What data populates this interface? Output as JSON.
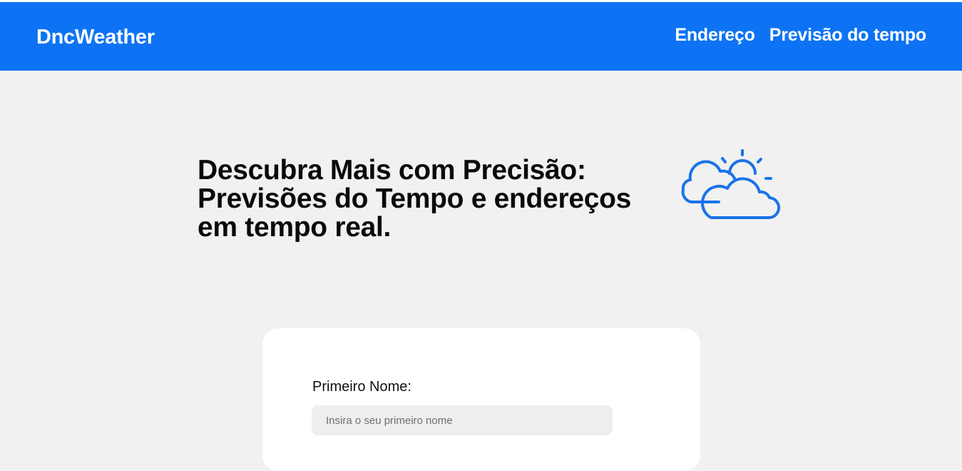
{
  "header": {
    "brand": "DncWeather",
    "nav": [
      {
        "label": "Endereço"
      },
      {
        "label": "Previsão do tempo"
      }
    ]
  },
  "hero": {
    "title_lines": [
      "Descubra Mais com Precisão:",
      "Previsões do Tempo e endereços",
      "em tempo real."
    ],
    "icon": "partly-cloudy-icon"
  },
  "form": {
    "first_name": {
      "label": "Primeiro Nome:",
      "placeholder": "Insira o seu primeiro nome",
      "value": ""
    }
  },
  "colors": {
    "primary": "#0d73f4",
    "background": "#f1f1f1",
    "card": "#ffffff",
    "input_bg": "#eeeeee",
    "icon_stroke": "#1a73e8"
  }
}
